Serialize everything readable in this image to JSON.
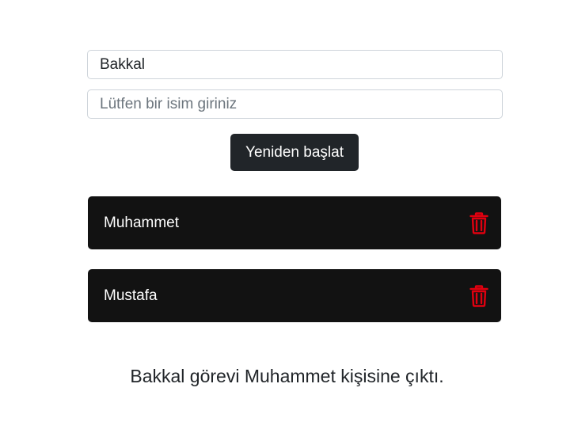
{
  "form": {
    "task_value": "Bakkal",
    "name_value": "",
    "name_placeholder": "Lütfen bir isim giriniz"
  },
  "restart_button": {
    "label": "Yeniden başlat"
  },
  "people": [
    {
      "name": "Muhammet",
      "delete_icon": "trash-icon"
    },
    {
      "name": "Mustafa",
      "delete_icon": "trash-icon"
    }
  ],
  "result": {
    "text": "Bakkal görevi Muhammet kişisine çıktı."
  },
  "colors": {
    "card_background": "#121212",
    "button_background": "#212529",
    "delete_icon": "#e0000f"
  }
}
